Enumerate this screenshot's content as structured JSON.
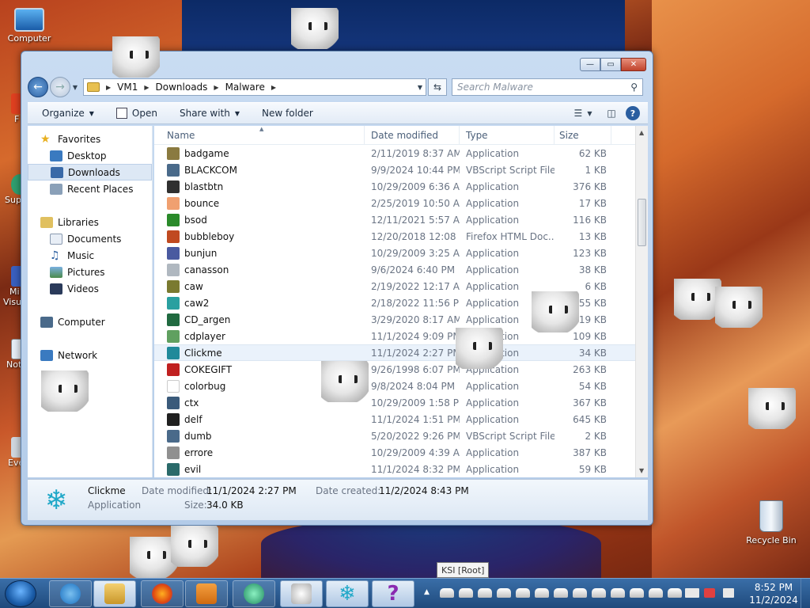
{
  "desktop": {
    "icons": [
      {
        "label": "Computer"
      },
      {
        "label": "Recycle Bin"
      }
    ],
    "partial_labels": [
      "F",
      "Sup",
      "Mi",
      "Visu",
      "Not",
      "Eve"
    ]
  },
  "window": {
    "controls": {
      "minimize": "—",
      "maximize": "▭",
      "close": "✕"
    },
    "address": {
      "crumbs": [
        "VM1",
        "Downloads",
        "Malware"
      ]
    },
    "search": {
      "placeholder": "Search Malware"
    },
    "toolbar": {
      "organize": "Organize",
      "open": "Open",
      "share_with": "Share with",
      "new_folder": "New folder"
    },
    "nav": {
      "favorites": "Favorites",
      "desktop": "Desktop",
      "downloads": "Downloads",
      "recent_places": "Recent Places",
      "libraries": "Libraries",
      "documents": "Documents",
      "music": "Music",
      "pictures": "Pictures",
      "videos": "Videos",
      "computer": "Computer",
      "network": "Network"
    },
    "columns": {
      "name": "Name",
      "date": "Date modified",
      "type": "Type",
      "size": "Size"
    },
    "files": [
      {
        "name": "badgame",
        "date": "2/11/2019 8:37 AM",
        "type": "Application",
        "size": "62 KB",
        "icon_color": "#8a7a40"
      },
      {
        "name": "BLACKCOM",
        "date": "9/9/2024 10:44 PM",
        "type": "VBScript Script File",
        "size": "1 KB",
        "icon_color": "#4a6a8a"
      },
      {
        "name": "blastbtn",
        "date": "10/29/2009 6:36 AM",
        "type": "Application",
        "size": "376 KB",
        "icon_color": "#303030"
      },
      {
        "name": "bounce",
        "date": "2/25/2019 10:50 AM",
        "type": "Application",
        "size": "17 KB",
        "icon_color": "#f0a070"
      },
      {
        "name": "bsod",
        "date": "12/11/2021 5:57 AM",
        "type": "Application",
        "size": "116 KB",
        "icon_color": "#2a8a2a"
      },
      {
        "name": "bubbleboy",
        "date": "12/20/2018 12:08 ...",
        "type": "Firefox HTML Doc...",
        "size": "13 KB",
        "icon_color": "#c04a20"
      },
      {
        "name": "bunjun",
        "date": "10/29/2009 3:25 AM",
        "type": "Application",
        "size": "123 KB",
        "icon_color": "#4a5aa0"
      },
      {
        "name": "canasson",
        "date": "9/6/2024 6:40 PM",
        "type": "Application",
        "size": "38 KB",
        "icon_color": "#b0b8c0"
      },
      {
        "name": "caw",
        "date": "2/19/2022 12:17 AM",
        "type": "Application",
        "size": "6 KB",
        "icon_color": "#7a7a30"
      },
      {
        "name": "caw2",
        "date": "2/18/2022 11:56 PM",
        "type": "Application",
        "size": "55 KB",
        "icon_color": "#2aa0a0"
      },
      {
        "name": "CD_argen",
        "date": "3/29/2020 8:17 AM",
        "type": "Application",
        "size": "19 KB",
        "icon_color": "#206a40"
      },
      {
        "name": "cdplayer",
        "date": "11/1/2024 9:09 PM",
        "type": "Application",
        "size": "109 KB",
        "icon_color": "#60a060"
      },
      {
        "name": "Clickme",
        "date": "11/1/2024 2:27 PM",
        "type": "Application",
        "size": "34 KB",
        "icon_color": "#208a9a"
      },
      {
        "name": "COKEGIFT",
        "date": "9/26/1998 6:07 PM",
        "type": "Application",
        "size": "263 KB",
        "icon_color": "#c02020"
      },
      {
        "name": "colorbug",
        "date": "9/8/2024 8:04 PM",
        "type": "Application",
        "size": "54 KB",
        "icon_color": "#ffffff"
      },
      {
        "name": "ctx",
        "date": "10/29/2009 1:58 PM",
        "type": "Application",
        "size": "367 KB",
        "icon_color": "#3a5a7a"
      },
      {
        "name": "delf",
        "date": "11/1/2024 1:51 PM",
        "type": "Application",
        "size": "645 KB",
        "icon_color": "#202020"
      },
      {
        "name": "dumb",
        "date": "5/20/2022 9:26 PM",
        "type": "VBScript Script File",
        "size": "2 KB",
        "icon_color": "#4a6a8a"
      },
      {
        "name": "errore",
        "date": "10/29/2009 4:39 AM",
        "type": "Application",
        "size": "387 KB",
        "icon_color": "#909090"
      },
      {
        "name": "evil",
        "date": "11/1/2024 8:32 PM",
        "type": "Application",
        "size": "59 KB",
        "icon_color": "#2a6a6a"
      }
    ],
    "selected_file": "Clickme",
    "details": {
      "name": "Clickme",
      "type": "Application",
      "date_modified_label": "Date modified:",
      "date_modified": "11/1/2024 2:27 PM",
      "date_created_label": "Date created:",
      "date_created": "11/2/2024 8:43 PM",
      "size_label": "Size:",
      "size": "34.0 KB"
    }
  },
  "tooltip": "KSI [Root]",
  "taskbar": {
    "clock_time": "8:52 PM",
    "clock_date": "11/2/2024",
    "pinned": [
      "ie-icon",
      "explorer-icon",
      "firefox-icon",
      "media-player-icon",
      "green-app-icon",
      "polar-bear-icon",
      "snowflake-icon",
      "question-icon"
    ]
  },
  "colors": {
    "accent": "#2a5ea0",
    "taskbar": "#1f4a7c",
    "selection": "#eaf2fb"
  }
}
